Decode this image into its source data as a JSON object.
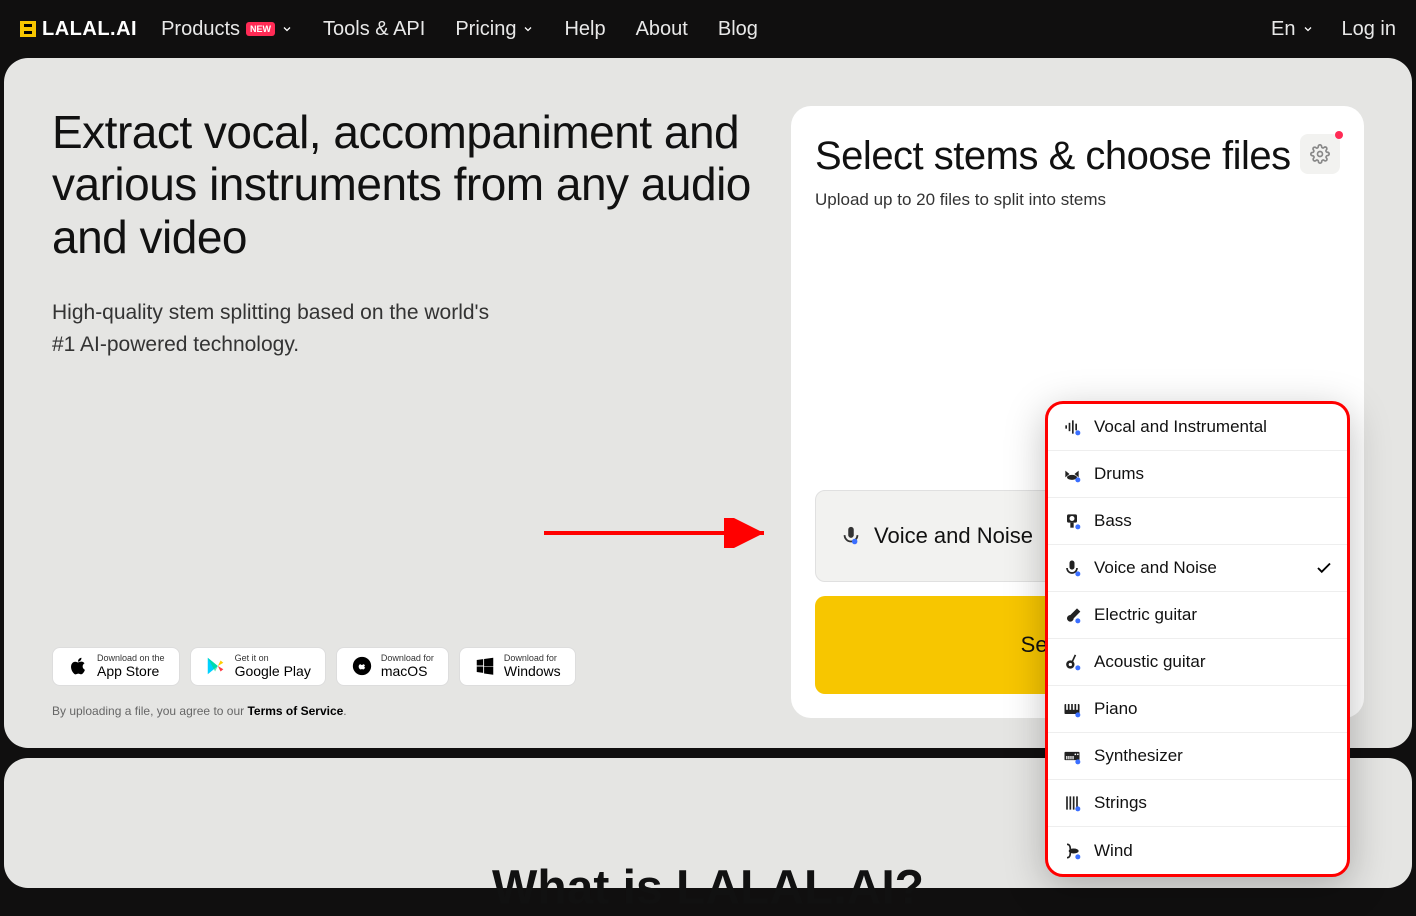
{
  "nav": {
    "logo_text": "LALAL.AI",
    "items": [
      "Products",
      "Tools & API",
      "Pricing",
      "Help",
      "About",
      "Blog"
    ],
    "new_badge": "NEW",
    "lang": "En",
    "login": "Log in"
  },
  "hero": {
    "title": "Extract vocal, accompaniment and various instruments from any audio and video",
    "subtitle": "High-quality stem splitting based on the world's #1 AI-powered technology."
  },
  "downloads": [
    {
      "top": "Download on the",
      "bottom": "App Store",
      "icon": "apple"
    },
    {
      "top": "Get it on",
      "bottom": "Google Play",
      "icon": "play"
    },
    {
      "top": "Download for",
      "bottom": "macOS",
      "icon": "macos"
    },
    {
      "top": "Download for",
      "bottom": "Windows",
      "icon": "windows"
    }
  ],
  "terms": {
    "prefix": "By uploading a file, you agree to our ",
    "link": "Terms of Service",
    "suffix": "."
  },
  "panel": {
    "title": "Select stems & choose files",
    "subtitle": "Upload up to 20 files to split into stems",
    "selected_stem": "Voice and Noise",
    "button": "Select Files"
  },
  "dropdown": {
    "items": [
      {
        "label": "Vocal and Instrumental",
        "selected": false,
        "icon": "vocals"
      },
      {
        "label": "Drums",
        "selected": false,
        "icon": "drums"
      },
      {
        "label": "Bass",
        "selected": false,
        "icon": "bass"
      },
      {
        "label": "Voice and Noise",
        "selected": true,
        "icon": "voice"
      },
      {
        "label": "Electric guitar",
        "selected": false,
        "icon": "eguitar"
      },
      {
        "label": "Acoustic guitar",
        "selected": false,
        "icon": "aguitar"
      },
      {
        "label": "Piano",
        "selected": false,
        "icon": "piano"
      },
      {
        "label": "Synthesizer",
        "selected": false,
        "icon": "synth"
      },
      {
        "label": "Strings",
        "selected": false,
        "icon": "strings"
      },
      {
        "label": "Wind",
        "selected": false,
        "icon": "wind"
      }
    ]
  },
  "next_section_title": "What is LALAL.AI?"
}
